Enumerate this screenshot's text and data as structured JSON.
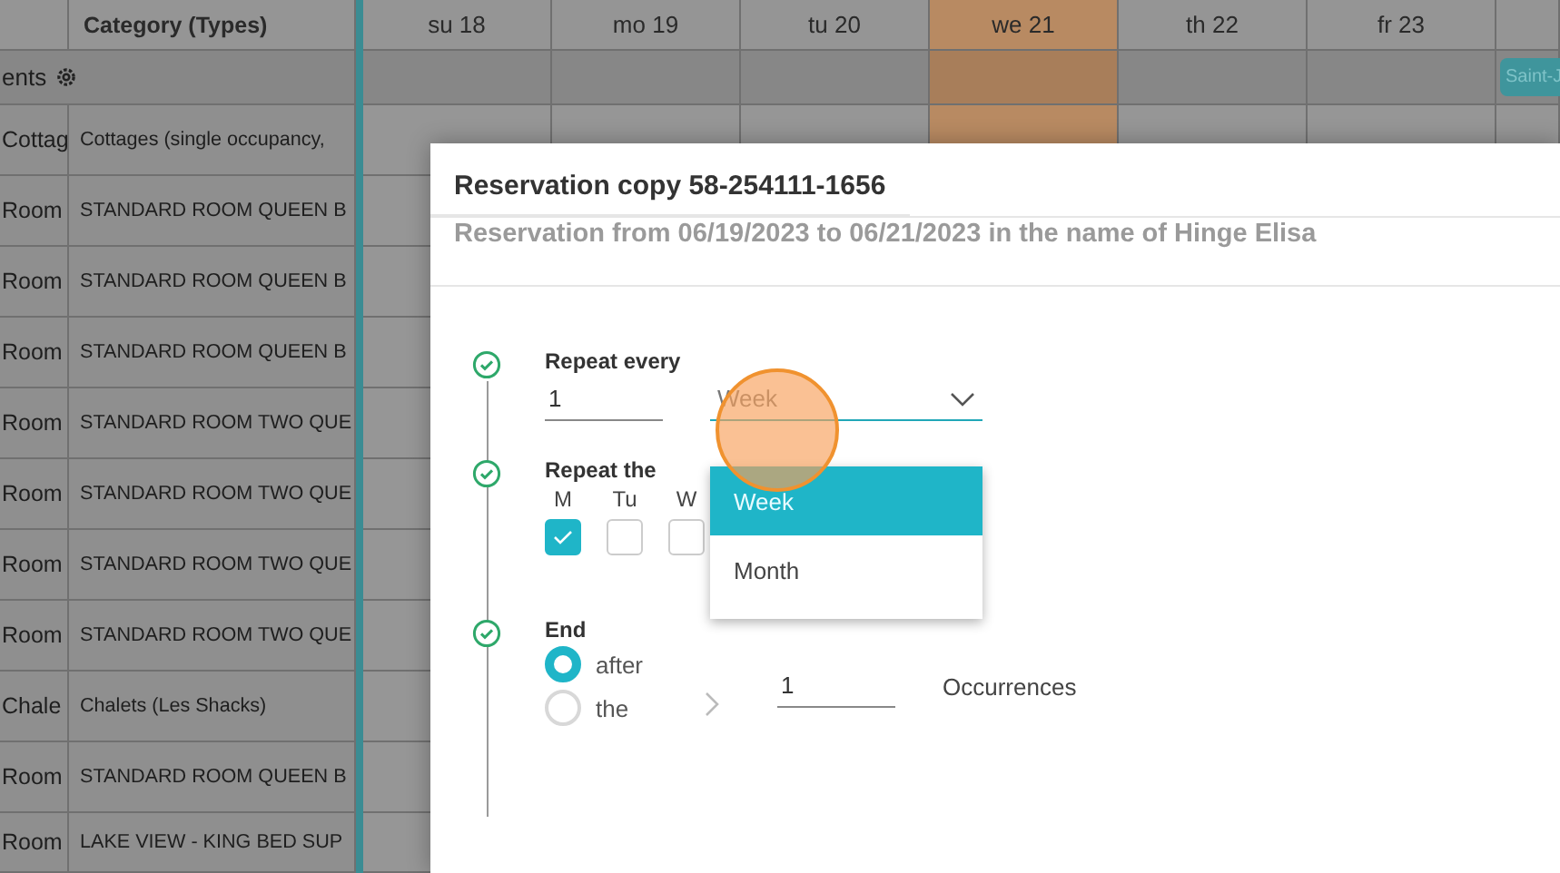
{
  "grid": {
    "category_header": "Category (Types)",
    "days": [
      {
        "label": "su 18",
        "highlighted": false
      },
      {
        "label": "mo 19",
        "highlighted": false
      },
      {
        "label": "tu 20",
        "highlighted": false
      },
      {
        "label": "we 21",
        "highlighted": true
      },
      {
        "label": "th 22",
        "highlighted": false
      },
      {
        "label": "fr 23",
        "highlighted": false
      }
    ],
    "group_row": {
      "label": "ents",
      "event": "Saint-J"
    },
    "rows": [
      {
        "column_1": "Cottag",
        "category": "Cottages (single occupancy,"
      },
      {
        "column_1": "Room",
        "category": "STANDARD ROOM QUEEN B"
      },
      {
        "column_1": "Room",
        "category": "STANDARD ROOM QUEEN B"
      },
      {
        "column_1": "Room",
        "category": "STANDARD ROOM QUEEN B"
      },
      {
        "column_1": "Room",
        "category": "STANDARD ROOM TWO QUE"
      },
      {
        "column_1": "Room",
        "category": "STANDARD ROOM TWO QUE"
      },
      {
        "column_1": "Room",
        "category": "STANDARD ROOM TWO QUE"
      },
      {
        "column_1": "Room",
        "category": "STANDARD ROOM TWO QUE"
      },
      {
        "column_1": "Chale",
        "category": "Chalets (Les Shacks)"
      },
      {
        "column_1": "Room",
        "category": "STANDARD ROOM QUEEN B"
      },
      {
        "column_1": "Room",
        "category": "LAKE VIEW - KING BED SUP"
      }
    ]
  },
  "dialog": {
    "title": "Reservation copy 58-254111-1656",
    "subtitle": "Reservation from 06/19/2023 to 06/21/2023 in the name of Hinge Elisa",
    "steps": [
      {
        "kind": "repeat_every",
        "label": "Repeat every",
        "count": "1",
        "unit": "Week"
      },
      {
        "kind": "weekdays",
        "label": "Repeat the",
        "days": [
          {
            "label": "M",
            "checked": true
          },
          {
            "label": "Tu",
            "checked": false
          },
          {
            "label": "W",
            "checked": false
          }
        ]
      },
      {
        "kind": "end",
        "label": "End",
        "options": [
          {
            "label": "after",
            "selected": true
          },
          {
            "label": "the",
            "selected": false
          }
        ],
        "count": "1",
        "count_label": "Occurrences"
      }
    ],
    "dropdown": {
      "options": [
        {
          "label": "Week",
          "selected": true
        },
        {
          "label": "Month",
          "selected": false
        }
      ]
    }
  }
}
